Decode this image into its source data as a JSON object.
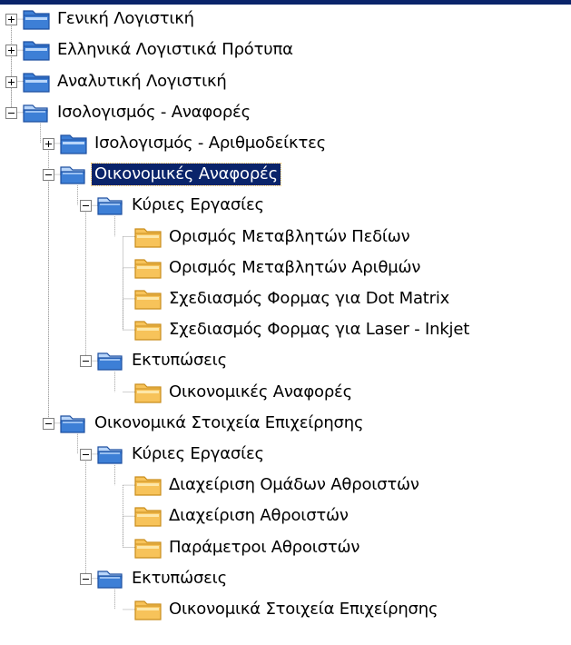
{
  "colors": {
    "selection_bg": "#0a246a",
    "selection_text": "#ffffff",
    "blue_folder": "#3d7fd6",
    "yellow_folder": "#f7c35a",
    "tree_line": "#a0a0a0"
  },
  "tree": [
    {
      "label": "Γενική Λογιστική",
      "icon": "blue-folder-icon",
      "state": "collapsed",
      "selected": false
    },
    {
      "label": "Ελληνικά Λογιστικά Πρότυπα",
      "icon": "blue-folder-icon",
      "state": "collapsed",
      "selected": false
    },
    {
      "label": "Αναλυτική Λογιστική",
      "icon": "blue-folder-icon",
      "state": "collapsed",
      "selected": false
    },
    {
      "label": "Ισολογισμός - Αναφορές",
      "icon": "blue-folder-open-icon",
      "state": "expanded",
      "selected": false
    },
    {
      "label": "Ισολογισμός - Αριθμοδείκτες",
      "icon": "blue-folder-icon",
      "state": "collapsed",
      "selected": false
    },
    {
      "label": "Οικονομικές Αναφορές",
      "icon": "blue-folder-open-icon",
      "state": "expanded",
      "selected": true
    },
    {
      "label": "Κύριες Εργασίες",
      "icon": "blue-folder-open-icon",
      "state": "expanded",
      "selected": false
    },
    {
      "label": "Ορισμός Μεταβλητών Πεδίων",
      "icon": "yellow-folder-icon",
      "state": "leaf",
      "selected": false
    },
    {
      "label": "Ορισμός Μεταβλητών Αριθμών",
      "icon": "yellow-folder-icon",
      "state": "leaf",
      "selected": false
    },
    {
      "label": "Σχεδιασμός Φορμας για Dot Matrix",
      "icon": "yellow-folder-icon",
      "state": "leaf",
      "selected": false
    },
    {
      "label": "Σχεδιασμός Φορμας για Laser - Inkjet",
      "icon": "yellow-folder-icon",
      "state": "leaf",
      "selected": false
    },
    {
      "label": "Εκτυπώσεις",
      "icon": "blue-folder-open-icon",
      "state": "expanded",
      "selected": false
    },
    {
      "label": "Οικονομικές Αναφορές",
      "icon": "yellow-folder-icon",
      "state": "leaf",
      "selected": false
    },
    {
      "label": "Οικονομικά Στοιχεία Επιχείρησης",
      "icon": "blue-folder-open-icon",
      "state": "expanded",
      "selected": false
    },
    {
      "label": "Κύριες Εργασίες",
      "icon": "blue-folder-open-icon",
      "state": "expanded",
      "selected": false
    },
    {
      "label": "Διαχείριση Ομάδων Αθροιστών",
      "icon": "yellow-folder-icon",
      "state": "leaf",
      "selected": false
    },
    {
      "label": "Διαχείριση Αθροιστών",
      "icon": "yellow-folder-icon",
      "state": "leaf",
      "selected": false
    },
    {
      "label": "Παράμετροι Αθροιστών",
      "icon": "yellow-folder-icon",
      "state": "leaf",
      "selected": false
    },
    {
      "label": "Εκτυπώσεις",
      "icon": "blue-folder-open-icon",
      "state": "expanded",
      "selected": false
    },
    {
      "label": "Οικονομικά Στοιχεία Επιχείρησης",
      "icon": "yellow-folder-icon",
      "state": "leaf",
      "selected": false
    }
  ]
}
